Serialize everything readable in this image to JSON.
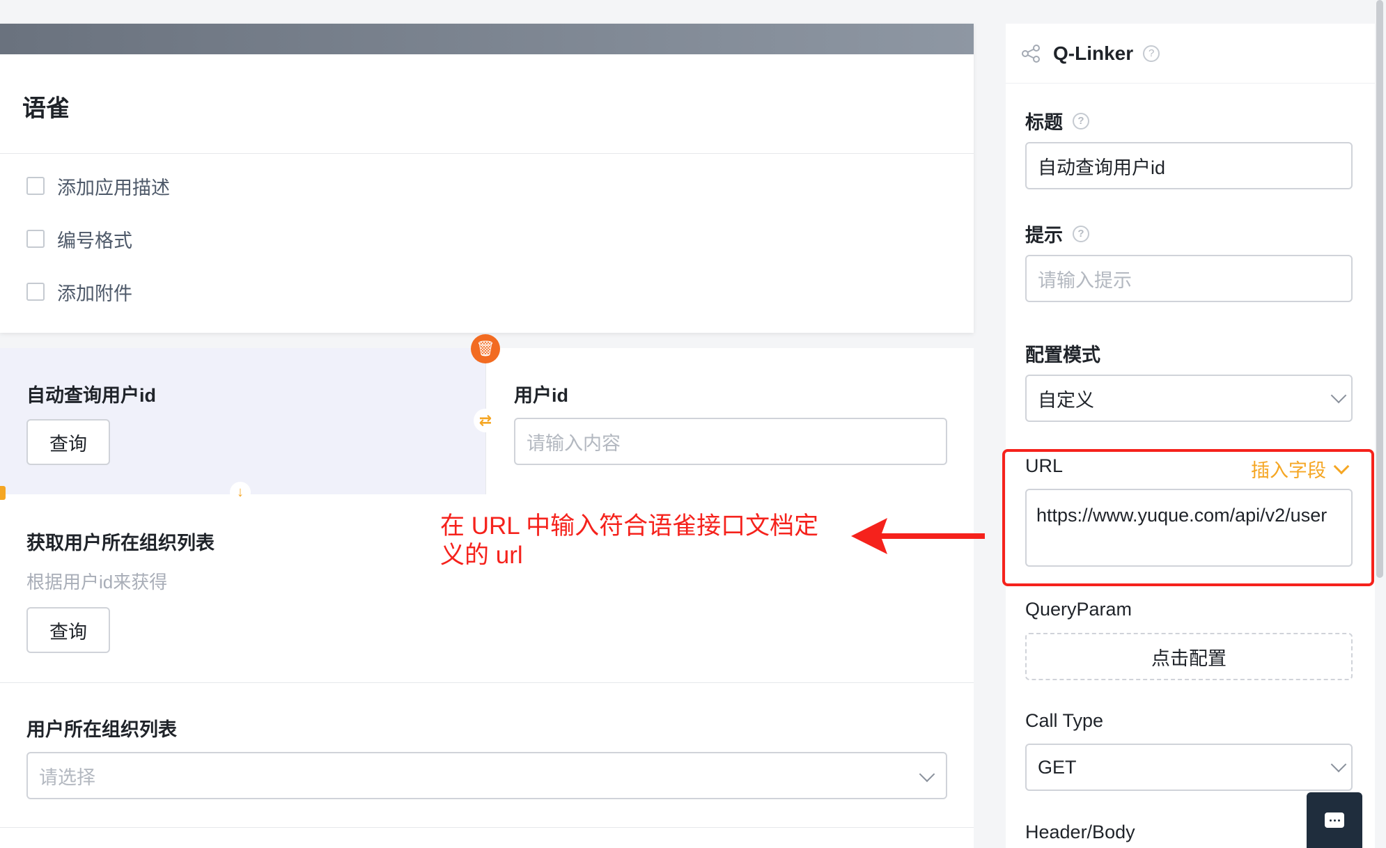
{
  "app": {
    "title": "语雀",
    "meta": [
      {
        "label": "添加应用描述",
        "icon": "comment-icon"
      },
      {
        "label": "编号格式",
        "icon": "numbering-icon"
      },
      {
        "label": "添加附件",
        "icon": "attachment-icon"
      }
    ]
  },
  "form": {
    "field1": {
      "label": "自动查询用户id",
      "button": "查询"
    },
    "field2": {
      "label": "用户id",
      "placeholder": "请输入内容"
    },
    "field3": {
      "label": "获取用户所在组织列表",
      "desc": "根据用户id来获得",
      "button": "查询"
    },
    "field4": {
      "label": "用户所在组织列表",
      "placeholder": "请选择"
    }
  },
  "annotation": {
    "text": "在 URL 中输入符合语雀接口文档定义的 url",
    "color": "#f5221c"
  },
  "panel": {
    "title": "Q-Linker",
    "title_field": {
      "label": "标题",
      "value": "自动查询用户id"
    },
    "hint_field": {
      "label": "提示",
      "placeholder": "请输入提示"
    },
    "mode_field": {
      "label": "配置模式",
      "value": "自定义"
    },
    "url_field": {
      "label": "URL",
      "insert_label": "插入字段",
      "value": "https://www.yuque.com/api/v2/user"
    },
    "query_param": {
      "label": "QueryParam",
      "button": "点击配置"
    },
    "call_type": {
      "label": "Call Type",
      "value": "GET"
    },
    "header_body": {
      "label": "Header/Body"
    }
  },
  "colors": {
    "accent": "#f5a623",
    "danger": "#f26b21",
    "annotation": "#f5221c"
  }
}
